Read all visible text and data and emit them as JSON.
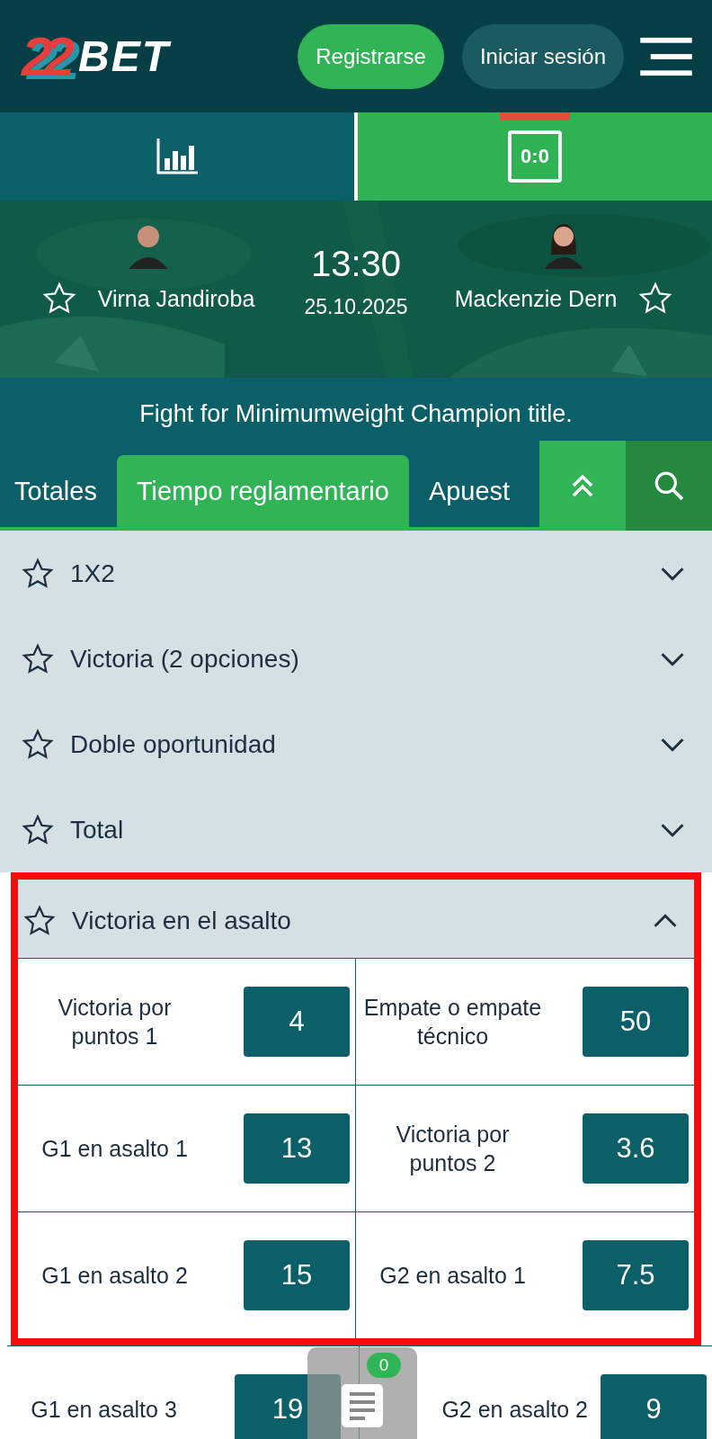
{
  "header": {
    "logo": {
      "digits": "22",
      "word": "BET"
    },
    "register_button": "Registrarse",
    "login_button": "Iniciar sesión"
  },
  "top_tabs": [
    {
      "kind": "stats",
      "selected": false
    },
    {
      "kind": "scoreboard",
      "selected": true,
      "label": "0:0"
    }
  ],
  "event": {
    "time": "13:30",
    "date": "25.10.2025",
    "home": {
      "name": "Virna Jandiroba",
      "favorite": false
    },
    "away": {
      "name": "Mackenzie Dern",
      "favorite": false
    }
  },
  "event_title": "Fight for Minimumweight Champion title.",
  "market_tabs": [
    {
      "label": "Totales",
      "selected": false
    },
    {
      "label": "Tiempo reglamentario",
      "selected": true
    },
    {
      "label": "Apuest",
      "selected": false
    }
  ],
  "markets": [
    {
      "name": "1X2",
      "favorite": false,
      "expanded": false,
      "highlighted": false
    },
    {
      "name": "Victoria (2 opciones)",
      "favorite": false,
      "expanded": false,
      "highlighted": false
    },
    {
      "name": "Doble oportunidad",
      "favorite": false,
      "expanded": false,
      "highlighted": false
    },
    {
      "name": "Total",
      "favorite": false,
      "expanded": false,
      "highlighted": false
    },
    {
      "name": "Victoria en el asalto",
      "favorite": false,
      "expanded": true,
      "highlighted": true,
      "outcomes": [
        {
          "label": "Victoria por puntos 1",
          "odds": "4"
        },
        {
          "label": "Empate o empate técnico",
          "odds": "50"
        },
        {
          "label": "G1 en asalto 1",
          "odds": "13"
        },
        {
          "label": "Victoria por puntos 2",
          "odds": "3.6"
        },
        {
          "label": "G1 en asalto 2",
          "odds": "15"
        },
        {
          "label": "G2 en asalto 1",
          "odds": "7.5"
        }
      ],
      "more_outcomes": [
        {
          "label": "G1 en asalto 3",
          "odds": "19"
        },
        {
          "label": "G2 en asalto 2",
          "odds": "9"
        }
      ]
    }
  ],
  "bet_slip": {
    "count": "0"
  }
}
